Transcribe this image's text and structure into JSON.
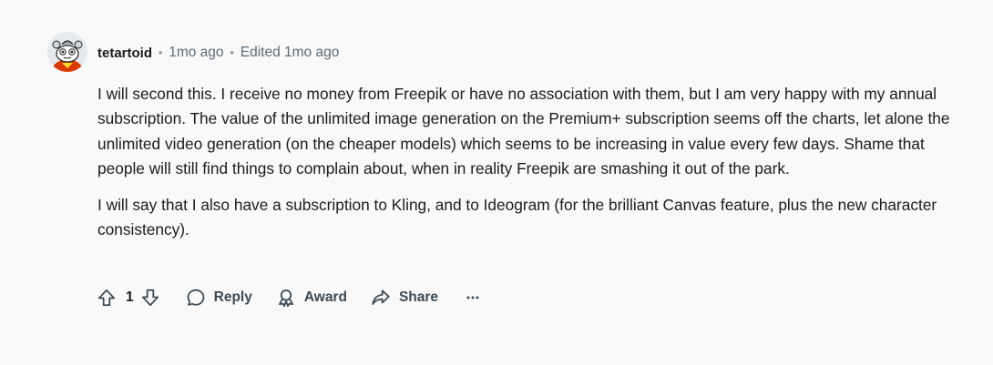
{
  "comment": {
    "author": "tetartoid",
    "separator": "•",
    "posted": "1mo ago",
    "edited": "Edited 1mo ago",
    "paragraphs": [
      "I will second this. I receive no money from Freepik or have no association with them, but I am very happy with my annual subscription. The value of the unlimited image generation on the Premium+ subscription seems off the charts, let alone the unlimited video generation (on the cheaper models) which seems to be increasing in value every few days. Shame that people will still find things to complain about, when in reality Freepik are smashing it out of the park.",
      "I will say that I also have a subscription to Kling, and to Ideogram (for the brilliant Canvas feature, plus the new character consistency)."
    ]
  },
  "actions": {
    "score": "1",
    "reply_label": "Reply",
    "award_label": "Award",
    "share_label": "Share"
  },
  "icons": {
    "upvote": "upvote-arrow-icon",
    "downvote": "downvote-arrow-icon",
    "reply": "speech-bubble-icon",
    "award": "award-ribbon-icon",
    "share": "share-arrow-icon",
    "more": "ellipsis-icon"
  },
  "colors": {
    "background": "#f9f9fa",
    "text": "#1c1c1c",
    "muted": "#5c6b75"
  }
}
